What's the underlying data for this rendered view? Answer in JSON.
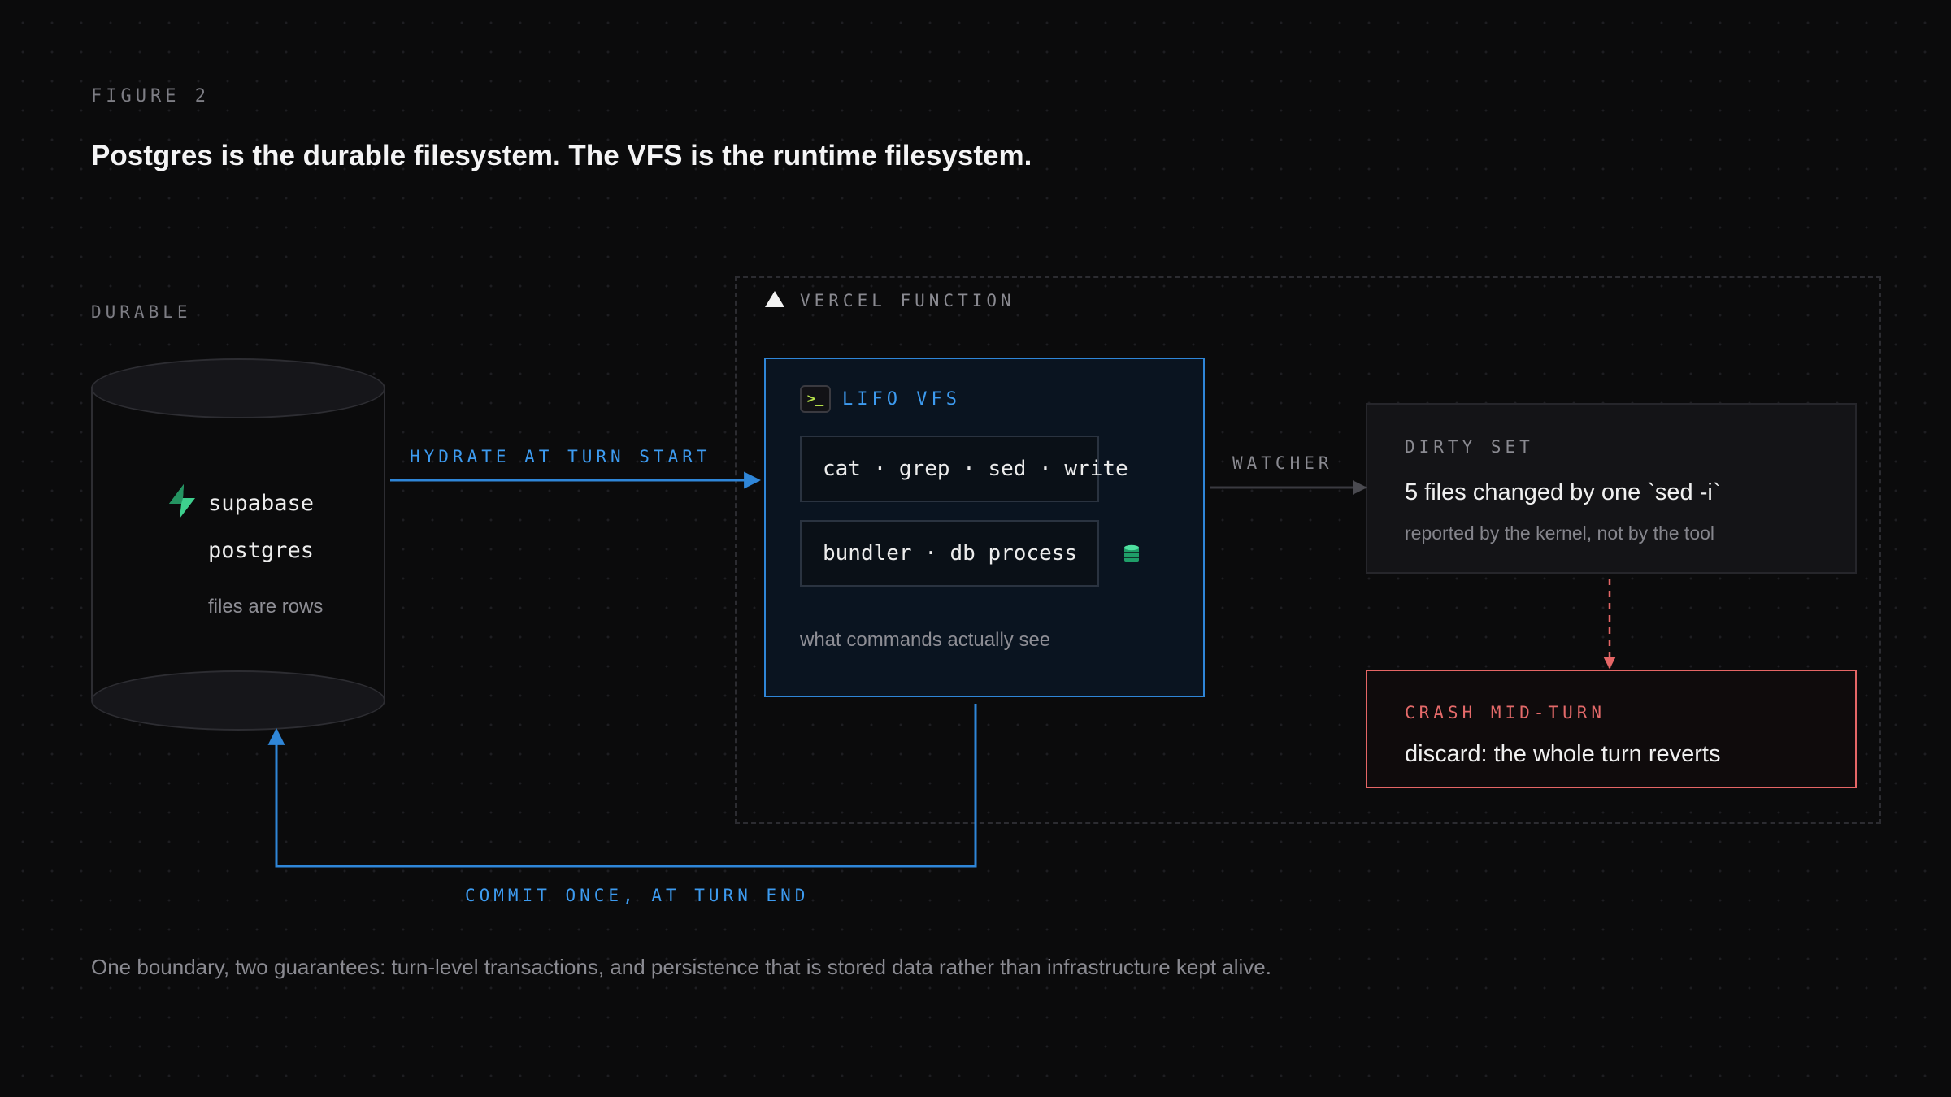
{
  "figure_label": "FIGURE 2",
  "title": "Postgres is the durable filesystem. The VFS is the runtime filesystem.",
  "durable": {
    "label": "DURABLE",
    "brand": "supabase",
    "db": "postgres",
    "note": "files are rows"
  },
  "vercel": {
    "label": "VERCEL FUNCTION",
    "icon": "vercel-triangle-icon"
  },
  "vfs": {
    "icon_glyph": ">_",
    "label": "LIFO VFS",
    "commands": "cat · grep · sed · write",
    "processes": "bundler · db process",
    "footnote": "what commands actually see"
  },
  "edges": {
    "hydrate": "HYDRATE AT TURN START",
    "watcher": "WATCHER",
    "commit": "COMMIT ONCE, AT TURN END"
  },
  "dirty_set": {
    "label": "DIRTY SET",
    "main": "5 files changed by one `sed -i`",
    "sub": "reported by the kernel, not by the tool"
  },
  "crash": {
    "label": "CRASH MID-TURN",
    "main": "discard: the whole turn reverts"
  },
  "caption": "One boundary, two guarantees: turn-level transactions, and persistence that is stored data rather than infrastructure kept alive.",
  "colors": {
    "background": "#0b0b0c",
    "accent_blue": "#2f86d8",
    "accent_red": "#e56666",
    "supabase_green": "#3ecf8e",
    "muted_text": "#8a8a91"
  }
}
